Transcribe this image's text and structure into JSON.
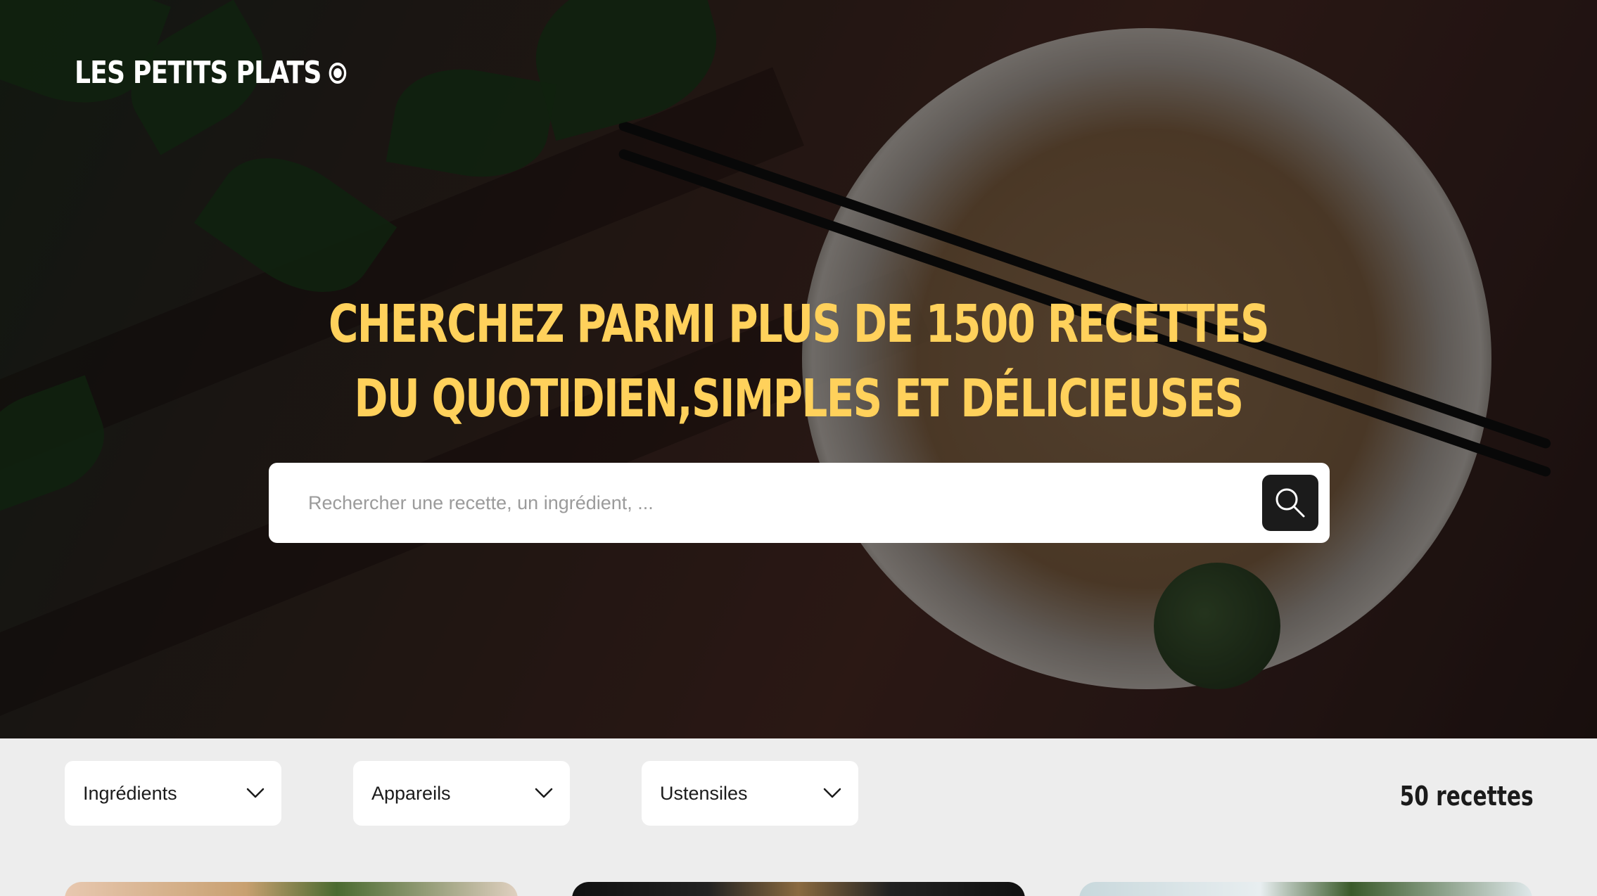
{
  "header": {
    "logo_text": "LES PETITS PLATS",
    "logo_icon": "circle-dot-icon"
  },
  "hero": {
    "headline_line1": "CHERCHEZ PARMI PLUS DE 1500 RECETTES",
    "headline_line2": "DU QUOTIDIEN,SIMPLES ET DÉLICIEUSES",
    "headline_color": "#ffd15b"
  },
  "search": {
    "placeholder": "Rechercher une recette, un ingrédient, ...",
    "value": "",
    "button_icon": "search-icon"
  },
  "filters": {
    "items": [
      {
        "label": "Ingrédients",
        "icon": "chevron-down-icon"
      },
      {
        "label": "Appareils",
        "icon": "chevron-down-icon"
      },
      {
        "label": "Ustensiles",
        "icon": "chevron-down-icon"
      }
    ],
    "recipe_count": "50 recettes"
  }
}
